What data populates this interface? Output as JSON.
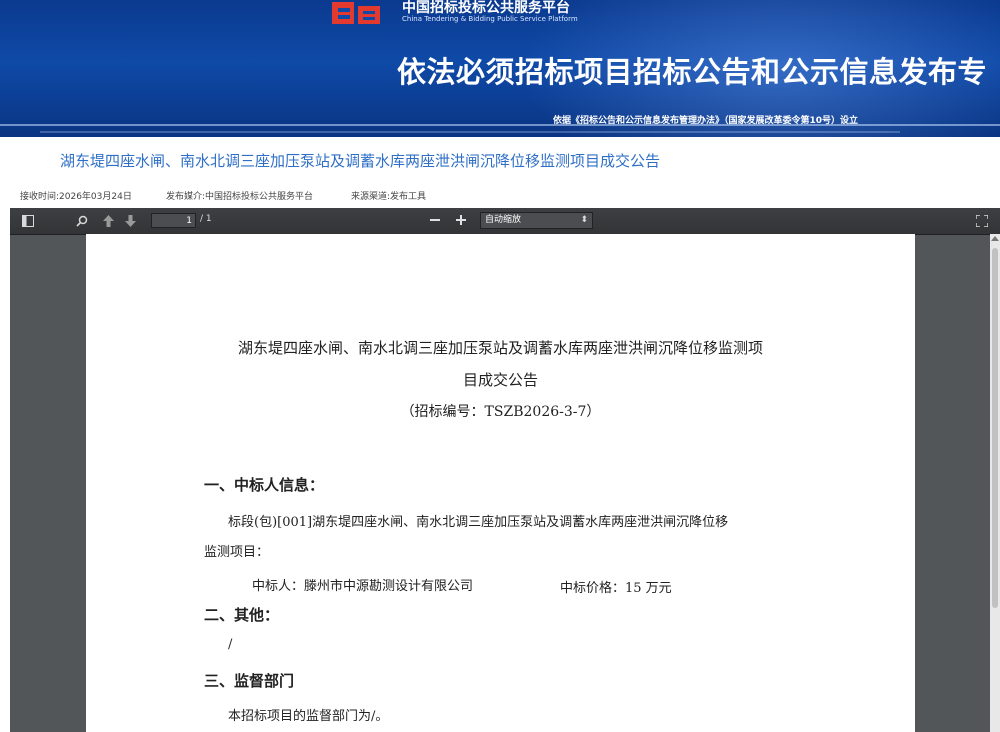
{
  "banner": {
    "platform_name_cn": "中国招标投标公共服务平台",
    "platform_name_en": "China Tendering & Bidding Public Service Platform",
    "headline": "依法必须招标项目招标公告和公示信息发布专",
    "basis": "依据《招标公告和公示信息发布管理办法》（国家发展改革委令第10号）设立"
  },
  "title": "湖东堤四座水闸、南水北调三座加压泵站及调蓄水库两座泄洪闸沉降位移监测项目成交公告",
  "meta": {
    "received_time": "接收时间:2026年03月24日",
    "media": "发布媒介:中国招标投标公共服务平台",
    "source": "来源渠道:发布工具"
  },
  "viewer": {
    "page_current": "1",
    "page_total": "/ 1",
    "zoom_label": "自动缩放",
    "icons": {
      "sidebar": "sidebar-toggle-icon",
      "search": "search-icon",
      "prev": "arrow-up-icon",
      "next": "arrow-down-icon",
      "zoom_out": "minus-icon",
      "zoom_in": "plus-icon",
      "fullscreen": "fullscreen-icon"
    }
  },
  "document": {
    "title_line1": "湖东堤四座水闸、南水北调三座加压泵站及调蓄水库两座泄洪闸沉降位移监测项",
    "title_line2": "目成交公告",
    "code": "（招标编号：TSZB2026-3-7）",
    "section1_heading": "一、中标人信息：",
    "section1_line1": "标段(包)[001]湖东堤四座水闸、南水北调三座加压泵站及调蓄水库两座泄洪闸沉降位移",
    "section1_line2": "监测项目：",
    "winner": "中标人：滕州市中源勘测设计有限公司",
    "price": "中标价格：15 万元",
    "section2_heading": "二、其他：",
    "section2_body": "/",
    "section3_heading": "三、监督部门",
    "section3_body": "本招标项目的监督部门为/。"
  }
}
